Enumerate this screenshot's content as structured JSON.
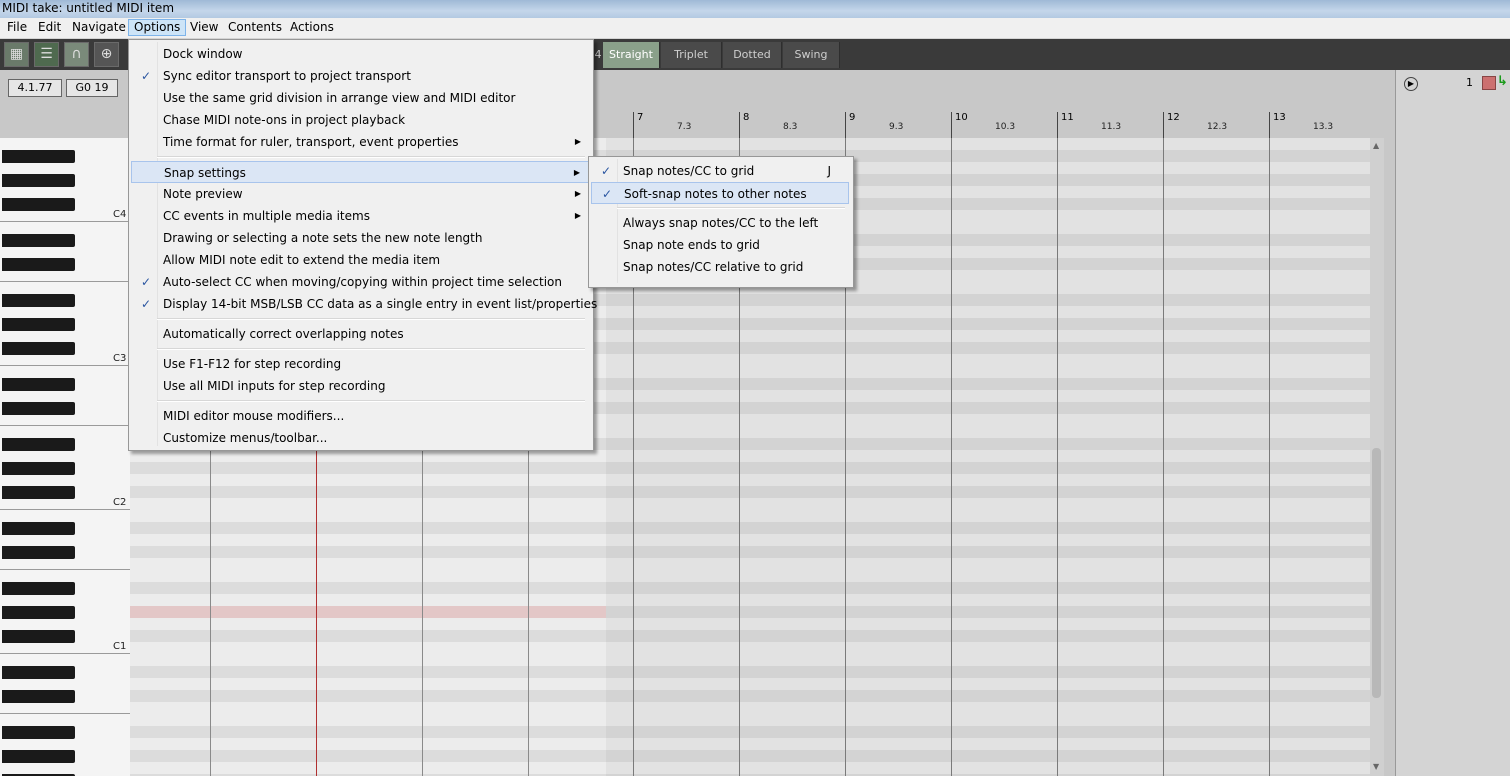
{
  "window": {
    "title": "MIDI take: untitled MIDI item"
  },
  "menubar": {
    "items": [
      "File",
      "Edit",
      "Navigate",
      "Options",
      "View",
      "Contents",
      "Actions"
    ],
    "active": "Options"
  },
  "toolbar": {
    "partial_label": "4",
    "swing_buttons": [
      "Straight",
      "Triplet",
      "Dotted",
      "Swing"
    ],
    "selected": "Straight"
  },
  "info": {
    "position": "4.1.77",
    "note": "G0  19"
  },
  "ruler": {
    "bars": [
      {
        "label": "7",
        "sub": "7.3"
      },
      {
        "label": "8",
        "sub": "8.3"
      },
      {
        "label": "9",
        "sub": "9.3"
      },
      {
        "label": "10",
        "sub": "10.3"
      },
      {
        "label": "11",
        "sub": "11.3"
      },
      {
        "label": "12",
        "sub": "12.3"
      },
      {
        "label": "13",
        "sub": "13.3"
      }
    ]
  },
  "piano": {
    "octave_labels": [
      "C4",
      "C3",
      "C2",
      "C1"
    ]
  },
  "right_panel": {
    "value": "1"
  },
  "options_menu": {
    "groups": [
      [
        {
          "label": "Dock window",
          "checked": false,
          "submenu": false
        },
        {
          "label": "Sync editor transport to project transport",
          "checked": true,
          "submenu": false
        },
        {
          "label": "Use the same grid division in arrange view and MIDI editor",
          "checked": false,
          "submenu": false
        },
        {
          "label": "Chase MIDI note-ons in project playback",
          "checked": false,
          "submenu": false
        },
        {
          "label": "Time format for ruler, transport, event properties",
          "checked": false,
          "submenu": true
        }
      ],
      [
        {
          "label": "Snap settings",
          "checked": false,
          "submenu": true,
          "highlighted": true
        },
        {
          "label": "Note preview",
          "checked": false,
          "submenu": true
        },
        {
          "label": "CC events in multiple media items",
          "checked": false,
          "submenu": true
        },
        {
          "label": "Drawing or selecting a note sets the new note length",
          "checked": false,
          "submenu": false
        },
        {
          "label": "Allow MIDI note edit to extend the media item",
          "checked": false,
          "submenu": false
        },
        {
          "label": "Auto-select CC when moving/copying within project time selection",
          "checked": true,
          "submenu": false
        },
        {
          "label": "Display 14-bit MSB/LSB CC data as a single entry in event list/properties",
          "checked": true,
          "submenu": false
        }
      ],
      [
        {
          "label": "Automatically correct overlapping notes",
          "checked": false,
          "submenu": false
        }
      ],
      [
        {
          "label": "Use F1-F12 for step recording",
          "checked": false,
          "submenu": false
        },
        {
          "label": "Use all MIDI inputs for step recording",
          "checked": false,
          "submenu": false
        }
      ],
      [
        {
          "label": "MIDI editor mouse modifiers...",
          "checked": false,
          "submenu": false
        },
        {
          "label": "Customize menus/toolbar...",
          "checked": false,
          "submenu": false
        }
      ]
    ]
  },
  "snap_submenu": {
    "groups": [
      [
        {
          "label": "Snap notes/CC to grid",
          "checked": true,
          "shortcut": "J"
        },
        {
          "label": "Soft-snap notes to other notes",
          "checked": true,
          "shortcut": "",
          "highlighted": true
        }
      ],
      [
        {
          "label": "Always snap notes/CC to the left",
          "checked": false,
          "shortcut": ""
        },
        {
          "label": "Snap note ends to grid",
          "checked": false,
          "shortcut": ""
        },
        {
          "label": "Snap notes/CC relative to grid",
          "checked": false,
          "shortcut": ""
        }
      ]
    ]
  },
  "glyphs": {
    "check": "✓",
    "arrow": "▶"
  },
  "colors": {
    "menu_highlight": "#dbe6f5",
    "selected_swing": "#8aa08a",
    "playhead": "#b03030"
  }
}
